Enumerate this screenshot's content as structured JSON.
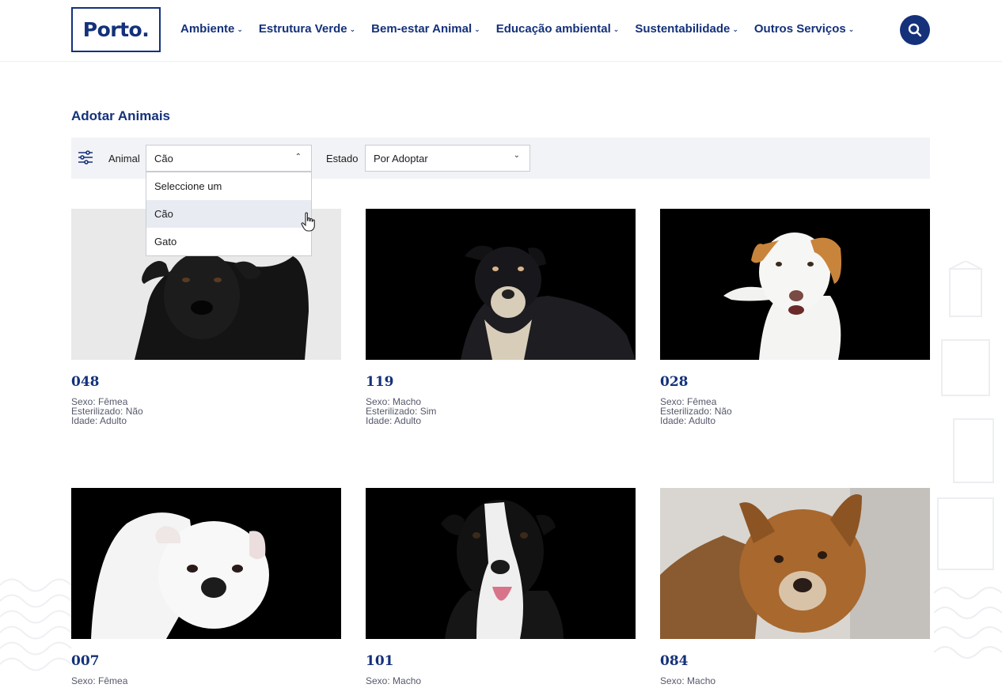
{
  "header": {
    "logo": "Porto.",
    "nav": [
      {
        "label": "Ambiente"
      },
      {
        "label": "Estrutura Verde"
      },
      {
        "label": "Bem-estar Animal"
      },
      {
        "label": "Educação ambiental"
      },
      {
        "label": "Sustentabilidade"
      },
      {
        "label": "Outros Serviços"
      }
    ]
  },
  "page": {
    "title": "Adotar Animais"
  },
  "filters": {
    "animal_label": "Animal",
    "animal_value": "Cão",
    "animal_options": [
      "Seleccione um",
      "Cão",
      "Gato"
    ],
    "estado_label": "Estado",
    "estado_value": "Por Adoptar"
  },
  "cards": [
    {
      "num": "048",
      "sexo": "Sexo: Fêmea",
      "esterilizado": "Esterilizado: Não",
      "idade": "Idade: Adulto"
    },
    {
      "num": "119",
      "sexo": "Sexo: Macho",
      "esterilizado": "Esterilizado: Sim",
      "idade": "Idade: Adulto"
    },
    {
      "num": "028",
      "sexo": "Sexo: Fêmea",
      "esterilizado": "Esterilizado: Não",
      "idade": "Idade: Adulto"
    },
    {
      "num": "007",
      "sexo": "Sexo: Fêmea"
    },
    {
      "num": "101",
      "sexo": "Sexo: Macho"
    },
    {
      "num": "084",
      "sexo": "Sexo: Macho"
    }
  ],
  "colors": {
    "brand": "#14317a",
    "filter_bg": "#f2f3f6",
    "photo_bg_dark": "#000000"
  },
  "icons": [
    "chevron-down-icon",
    "search-icon",
    "filter-sliders-icon",
    "chevron-up-icon",
    "hand-pointer-icon"
  ]
}
